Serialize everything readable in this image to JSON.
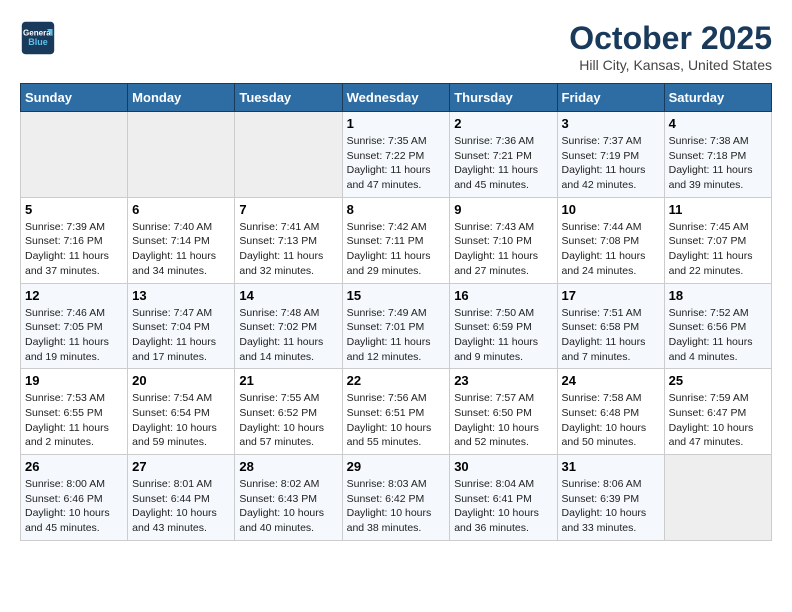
{
  "header": {
    "logo_line1": "General",
    "logo_line2": "Blue",
    "month": "October 2025",
    "location": "Hill City, Kansas, United States"
  },
  "weekdays": [
    "Sunday",
    "Monday",
    "Tuesday",
    "Wednesday",
    "Thursday",
    "Friday",
    "Saturday"
  ],
  "weeks": [
    [
      {
        "day": "",
        "info": ""
      },
      {
        "day": "",
        "info": ""
      },
      {
        "day": "",
        "info": ""
      },
      {
        "day": "1",
        "info": "Sunrise: 7:35 AM\nSunset: 7:22 PM\nDaylight: 11 hours and 47 minutes."
      },
      {
        "day": "2",
        "info": "Sunrise: 7:36 AM\nSunset: 7:21 PM\nDaylight: 11 hours and 45 minutes."
      },
      {
        "day": "3",
        "info": "Sunrise: 7:37 AM\nSunset: 7:19 PM\nDaylight: 11 hours and 42 minutes."
      },
      {
        "day": "4",
        "info": "Sunrise: 7:38 AM\nSunset: 7:18 PM\nDaylight: 11 hours and 39 minutes."
      }
    ],
    [
      {
        "day": "5",
        "info": "Sunrise: 7:39 AM\nSunset: 7:16 PM\nDaylight: 11 hours and 37 minutes."
      },
      {
        "day": "6",
        "info": "Sunrise: 7:40 AM\nSunset: 7:14 PM\nDaylight: 11 hours and 34 minutes."
      },
      {
        "day": "7",
        "info": "Sunrise: 7:41 AM\nSunset: 7:13 PM\nDaylight: 11 hours and 32 minutes."
      },
      {
        "day": "8",
        "info": "Sunrise: 7:42 AM\nSunset: 7:11 PM\nDaylight: 11 hours and 29 minutes."
      },
      {
        "day": "9",
        "info": "Sunrise: 7:43 AM\nSunset: 7:10 PM\nDaylight: 11 hours and 27 minutes."
      },
      {
        "day": "10",
        "info": "Sunrise: 7:44 AM\nSunset: 7:08 PM\nDaylight: 11 hours and 24 minutes."
      },
      {
        "day": "11",
        "info": "Sunrise: 7:45 AM\nSunset: 7:07 PM\nDaylight: 11 hours and 22 minutes."
      }
    ],
    [
      {
        "day": "12",
        "info": "Sunrise: 7:46 AM\nSunset: 7:05 PM\nDaylight: 11 hours and 19 minutes."
      },
      {
        "day": "13",
        "info": "Sunrise: 7:47 AM\nSunset: 7:04 PM\nDaylight: 11 hours and 17 minutes."
      },
      {
        "day": "14",
        "info": "Sunrise: 7:48 AM\nSunset: 7:02 PM\nDaylight: 11 hours and 14 minutes."
      },
      {
        "day": "15",
        "info": "Sunrise: 7:49 AM\nSunset: 7:01 PM\nDaylight: 11 hours and 12 minutes."
      },
      {
        "day": "16",
        "info": "Sunrise: 7:50 AM\nSunset: 6:59 PM\nDaylight: 11 hours and 9 minutes."
      },
      {
        "day": "17",
        "info": "Sunrise: 7:51 AM\nSunset: 6:58 PM\nDaylight: 11 hours and 7 minutes."
      },
      {
        "day": "18",
        "info": "Sunrise: 7:52 AM\nSunset: 6:56 PM\nDaylight: 11 hours and 4 minutes."
      }
    ],
    [
      {
        "day": "19",
        "info": "Sunrise: 7:53 AM\nSunset: 6:55 PM\nDaylight: 11 hours and 2 minutes."
      },
      {
        "day": "20",
        "info": "Sunrise: 7:54 AM\nSunset: 6:54 PM\nDaylight: 10 hours and 59 minutes."
      },
      {
        "day": "21",
        "info": "Sunrise: 7:55 AM\nSunset: 6:52 PM\nDaylight: 10 hours and 57 minutes."
      },
      {
        "day": "22",
        "info": "Sunrise: 7:56 AM\nSunset: 6:51 PM\nDaylight: 10 hours and 55 minutes."
      },
      {
        "day": "23",
        "info": "Sunrise: 7:57 AM\nSunset: 6:50 PM\nDaylight: 10 hours and 52 minutes."
      },
      {
        "day": "24",
        "info": "Sunrise: 7:58 AM\nSunset: 6:48 PM\nDaylight: 10 hours and 50 minutes."
      },
      {
        "day": "25",
        "info": "Sunrise: 7:59 AM\nSunset: 6:47 PM\nDaylight: 10 hours and 47 minutes."
      }
    ],
    [
      {
        "day": "26",
        "info": "Sunrise: 8:00 AM\nSunset: 6:46 PM\nDaylight: 10 hours and 45 minutes."
      },
      {
        "day": "27",
        "info": "Sunrise: 8:01 AM\nSunset: 6:44 PM\nDaylight: 10 hours and 43 minutes."
      },
      {
        "day": "28",
        "info": "Sunrise: 8:02 AM\nSunset: 6:43 PM\nDaylight: 10 hours and 40 minutes."
      },
      {
        "day": "29",
        "info": "Sunrise: 8:03 AM\nSunset: 6:42 PM\nDaylight: 10 hours and 38 minutes."
      },
      {
        "day": "30",
        "info": "Sunrise: 8:04 AM\nSunset: 6:41 PM\nDaylight: 10 hours and 36 minutes."
      },
      {
        "day": "31",
        "info": "Sunrise: 8:06 AM\nSunset: 6:39 PM\nDaylight: 10 hours and 33 minutes."
      },
      {
        "day": "",
        "info": ""
      }
    ]
  ]
}
